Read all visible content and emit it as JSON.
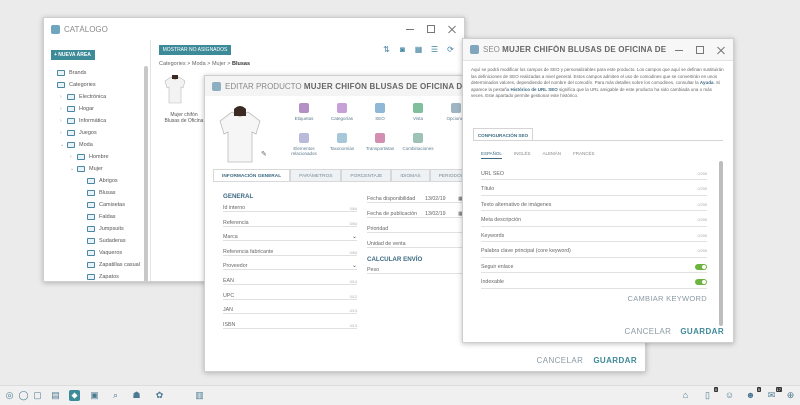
{
  "catalog": {
    "title": "CATÁLOGO",
    "new_area_label": "+ NUEVA ÁREA",
    "tree": [
      {
        "label": "Brands",
        "level": 0,
        "caret": ""
      },
      {
        "label": "Categories",
        "level": 0,
        "caret": ""
      },
      {
        "label": "Electrónica",
        "level": 1,
        "caret": "›"
      },
      {
        "label": "Hogar",
        "level": 1,
        "caret": "›"
      },
      {
        "label": "Informática",
        "level": 1,
        "caret": "›"
      },
      {
        "label": "Juegos",
        "level": 1,
        "caret": "›"
      },
      {
        "label": "Moda",
        "level": 1,
        "caret": "⌄"
      },
      {
        "label": "Hombre",
        "level": 2,
        "caret": "›"
      },
      {
        "label": "Mujer",
        "level": 2,
        "caret": "⌄"
      },
      {
        "label": "Abrigos",
        "level": 3,
        "caret": ""
      },
      {
        "label": "Blusas",
        "level": 3,
        "caret": ""
      },
      {
        "label": "Camisetas",
        "level": 3,
        "caret": ""
      },
      {
        "label": "Faldas",
        "level": 3,
        "caret": ""
      },
      {
        "label": "Jumpsuits",
        "level": 3,
        "caret": ""
      },
      {
        "label": "Sudaderas",
        "level": 3,
        "caret": ""
      },
      {
        "label": "Vaqueros",
        "level": 3,
        "caret": ""
      },
      {
        "label": "Zapatillas casual",
        "level": 3,
        "caret": ""
      },
      {
        "label": "Zapatos",
        "level": 3,
        "caret": ""
      }
    ],
    "show_unassigned_label": "MOSTRAR NO ASIGNADOS",
    "breadcrumb": [
      "Categories",
      "Moda",
      "Mujer",
      "Blusas"
    ],
    "product_label": "Mujer chifón Blusas de Oficina"
  },
  "editar": {
    "title_prefix": "EDITAR PRODUCTO",
    "title_name": "MUJER CHIFÓN BLUSAS DE OFICINA DE MANGA",
    "icons": [
      {
        "label": "Etiquetas",
        "icon": "tag-icon",
        "color": "#b48fc7"
      },
      {
        "label": "Categorías",
        "icon": "category-icon",
        "color": "#c6a0d6"
      },
      {
        "label": "SEO",
        "icon": "seo-icon",
        "color": "#8fb7d6"
      },
      {
        "label": "Vista",
        "icon": "view-icon",
        "color": "#7fbf9b"
      },
      {
        "label": "Opciones",
        "icon": "options-icon",
        "color": "#9fb5c4"
      },
      {
        "label": "",
        "icon": "",
        "color": ""
      },
      {
        "label": "Elementos relacionados",
        "icon": "related-icon",
        "color": "#b9b9d9"
      },
      {
        "label": "Taxonomías",
        "icon": "taxonomy-icon",
        "color": "#a6c8d8"
      },
      {
        "label": "Transportistas",
        "icon": "carrier-icon",
        "color": "#d28fb1"
      },
      {
        "label": "Combinaciones",
        "icon": "combinations-icon",
        "color": "#9fc2b7"
      }
    ],
    "tabs": [
      "INFORMACIÓN GENERAL",
      "PARÁMETROS",
      "PORCENTAJE",
      "IDIOMAS",
      "PERIODOS DE ACTIV"
    ],
    "general_heading": "GENERAL",
    "left_fields": [
      {
        "label": "Id interno",
        "count": "0/64",
        "type": "text"
      },
      {
        "label": "Referencia",
        "count": "0/64",
        "type": "text"
      },
      {
        "label": "Marca",
        "count": "",
        "type": "select"
      },
      {
        "label": "Referencia fabricante",
        "count": "0/64",
        "type": "text"
      },
      {
        "label": "Proveedor",
        "count": "",
        "type": "select"
      },
      {
        "label": "EAN",
        "count": "0/14",
        "type": "text"
      },
      {
        "label": "UPC",
        "count": "0/12",
        "type": "text"
      },
      {
        "label": "JAN",
        "count": "0/13",
        "type": "text"
      },
      {
        "label": "ISBN",
        "count": "0/13",
        "type": "text"
      }
    ],
    "right_fields": [
      {
        "label": "Fecha disponibilidad",
        "value": "13/02/19"
      },
      {
        "label": "Fecha de publicación",
        "value": "13/02/19"
      },
      {
        "label": "Prioridad",
        "value": ""
      },
      {
        "label": "Unidad de venta",
        "value": ""
      }
    ],
    "shipping_heading": "CALCULAR ENVÍO",
    "weight_label": "Peso",
    "cancel_label": "CANCELAR",
    "save_label": "GUARDAR"
  },
  "seo": {
    "title_prefix": "SEO",
    "title_name": "MUJER CHIFÓN BLUSAS DE OFICINA DE MANGA",
    "intro_1": "Aquí se podrá modificar los campos de SEO y personalizables para este producto. Los campos que aquí se definan sustituirán las definiciones de SEO realizadas a nivel general. Estos campos admiten el uso de comodines que se convertirán en unos determinados valores, dependiendo del nombre del comodín. Para más detalles sobre los comodines, consultar la ",
    "intro_link1": "Ayuda",
    "intro_2": ". Si aparece la pestaña ",
    "intro_link2": "Histórico de URL SEO",
    "intro_3": " significa que la URL amigable de este producto ha sido cambiada una o más veces. Este apartado permite gestionar este histórico.",
    "config_tab": "CONFIGURACIÓN SEO",
    "languages": [
      "ESPAÑOL",
      "INGLÉS",
      "ALEMÁN",
      "FRANCÉS"
    ],
    "fields": [
      {
        "label": "URL SEO",
        "count": "0/255"
      },
      {
        "label": "Título",
        "count": "0/255"
      },
      {
        "label": "Texto alternativo de imágenes",
        "count": "0/255"
      },
      {
        "label": "Meta descripción",
        "count": "0/255"
      },
      {
        "label": "Keywords",
        "count": "0/255"
      },
      {
        "label": "Palabra clave principal (core keyword)",
        "count": "0/255"
      }
    ],
    "toggles": [
      {
        "label": "Seguir enlace",
        "on": true
      },
      {
        "label": "Indexable",
        "on": true
      }
    ],
    "change_keyword_label": "CAMBIAR KEYWORD",
    "cancel_label": "CANCELAR",
    "save_label": "GUARDAR"
  },
  "taskbar": {
    "items": [
      "home-icon",
      "catalog-icon",
      "notes-icon",
      "products-icon",
      "tags-icon",
      "photo-icon",
      "search-icon",
      "tree-icon",
      "share-icon",
      "chart-icon"
    ],
    "right_items": [
      "home-icon",
      "docs-icon",
      "user-icon",
      "user-icon",
      "chat-icon",
      "add-icon"
    ],
    "badges": [
      "0",
      "5",
      "17"
    ]
  },
  "colors": {
    "accent": "#3d8a99",
    "toggle_on": "#6cb33f"
  }
}
